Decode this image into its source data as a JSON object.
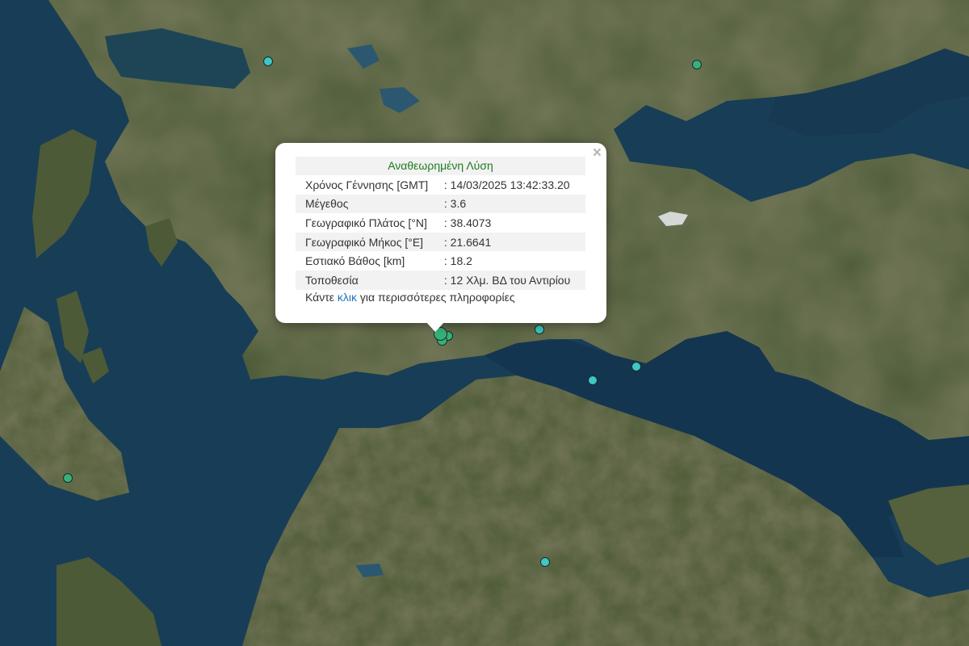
{
  "map": {
    "colors": {
      "sea": "#173a52",
      "land": "#4a5a36",
      "mountains": "#6e5c42",
      "lake": "#1f4f60"
    }
  },
  "markers": [
    {
      "name": "earthquake-marker",
      "color": "#3ec7c3",
      "lat": null,
      "lon": null
    },
    {
      "name": "earthquake-marker",
      "color": "#35b27a"
    },
    {
      "name": "earthquake-marker",
      "color": "#3ec7c3"
    },
    {
      "name": "earthquake-marker",
      "color": "#3ec7c3"
    },
    {
      "name": "earthquake-marker",
      "color": "#3ec7c3"
    },
    {
      "name": "earthquake-marker",
      "color": "#35b27a"
    },
    {
      "name": "earthquake-marker",
      "color": "#3ec7c3"
    },
    {
      "name": "selected-earthquake-marker",
      "color": "#35b27a"
    }
  ],
  "popup": {
    "title": "Αναθεωρημένη Λύση",
    "close": "×",
    "rows": [
      {
        "label": "Χρόνος Γέννησης [GMT]",
        "value": ": 14/03/2025 13:42:33.20"
      },
      {
        "label": "Μέγεθος",
        "value": ": 3.6"
      },
      {
        "label": "Γεωγραφικό Πλάτος [°N]",
        "value": ": 38.4073"
      },
      {
        "label": "Γεωγραφικό Μήκος [°E]",
        "value": ": 21.6641"
      },
      {
        "label": "Εστιακό Βάθος [km]",
        "value": ": 18.2"
      },
      {
        "label": "Τοποθεσία",
        "value": ": 12 Χλμ. ΒΔ του Αντιρίου"
      }
    ],
    "more_prefix": "Κάντε ",
    "more_link": "κλικ",
    "more_suffix": " για περισσότερες πληροφορίες"
  }
}
